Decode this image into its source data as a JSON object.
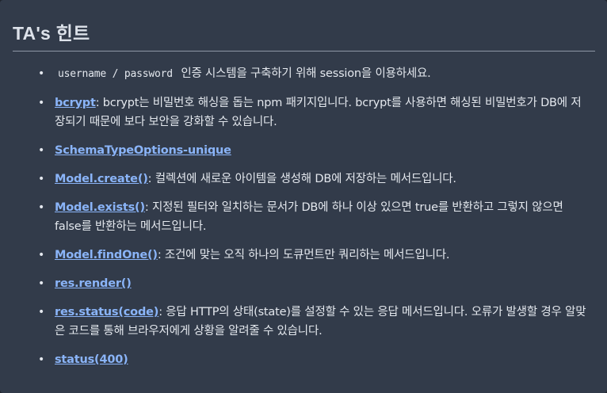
{
  "panel": {
    "title": "TA's 힌트"
  },
  "tips": [
    {
      "code": "username / password",
      "text": " 인증 시스템을 구축하기 위해 session을 이용하세요."
    },
    {
      "link": "bcrypt",
      "text": ": bcrypt는 비밀번호 해싱을 돕는 npm 패키지입니다. bcrypt를 사용하면 해싱된 비밀번호가 DB에 저장되기 때문에 보다 보안을 강화할 수 있습니다."
    },
    {
      "link": "SchemaTypeOptions-unique"
    },
    {
      "link": "Model.create()",
      "text": ": 컬렉션에 새로운 아이템을 생성해 DB에 저장하는 메서드입니다."
    },
    {
      "link": "Model.exists()",
      "text": ": 지정된 필터와 일치하는 문서가 DB에 하나 이상 있으면 true를 반환하고 그렇지 않으면 false를 반환하는 메서드입니다."
    },
    {
      "link": "Model.findOne()",
      "text": ": 조건에 맞는 오직 하나의 도큐먼트만 쿼리하는 메서드입니다."
    },
    {
      "link": "res.render()"
    },
    {
      "link": "res.status(code)",
      "text": ": 응답 HTTP의 상태(state)를 설정할 수 있는 응답 메서드입니다. 오류가 발생할 경우 알맞은 코드를 통해 브라우저에게 상황을 알려줄 수 있습니다."
    },
    {
      "link": "status(400)"
    }
  ],
  "colors": {
    "background": "#323b4a",
    "text": "#e4e8ee",
    "link": "#8ab4f8"
  }
}
